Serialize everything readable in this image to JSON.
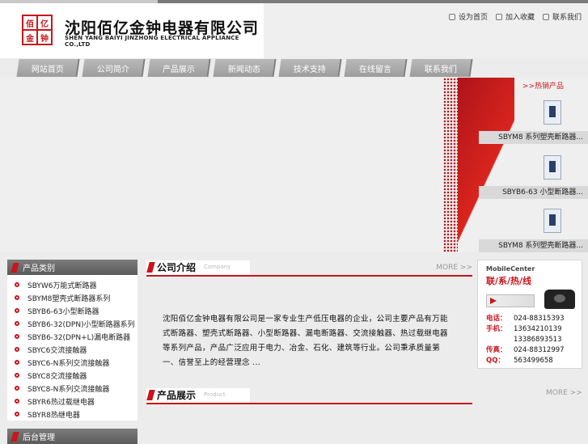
{
  "company": {
    "logo_chars": [
      "佰",
      "亿",
      "金",
      "钟"
    ],
    "name_cn": "沈阳佰亿金钟电器有限公司",
    "name_en": "SHEN YANG BAIYI JINZHONG ELECTRICAL APPLIANCE CO.,LTD"
  },
  "top_links": [
    {
      "label": "设为首页",
      "icon": "home-icon"
    },
    {
      "label": "加入收藏",
      "icon": "star-icon"
    },
    {
      "label": "联系我们",
      "icon": "contact-icon"
    }
  ],
  "nav": [
    "网站首页",
    "公司简介",
    "产品展示",
    "新闻动态",
    "技术支持",
    "在线留言",
    "联系我们"
  ],
  "promo": {
    "hot_label": ">>热销产品",
    "items": [
      {
        "caption": "SBYM8 系列塑壳断路器..."
      },
      {
        "caption": "SBYB6-63 小型断路器..."
      },
      {
        "caption": "SBYM8 系列塑壳断路器..."
      }
    ]
  },
  "sidebar": {
    "title": "产品类别",
    "items": [
      "SBYW6万能式断路器",
      "SBYM8塑壳式断路器系列",
      "SBYB6-63小型断路器",
      "SBYB6-32(DPN)小型断路器系列",
      "SBYB6-32(DPN+L)漏电断路器",
      "SBYC6交流接触器",
      "SBYC6-N系列交流接触器",
      "SBYC8交流接触器",
      "SBYC8-N系列交流接触器",
      "SBYR6热过载继电器",
      "SBYR8热继电器"
    ],
    "admin_title": "后台管理"
  },
  "intro": {
    "title": "公司介绍",
    "subtitle": "Company",
    "more": "MORE >>",
    "text": "沈阳佰亿金钟电器有限公司是一家专业生产低压电器的企业，公司主要产品有万能式断路器、塑壳式断路器、小型断路器、漏电断路器、交流接触器、热过载继电器等系列产品，产品广泛应用于电力、冶金、石化、建筑等行业。公司秉承质量第一、信誉至上的经营理念 ..."
  },
  "products": {
    "title": "产品展示",
    "subtitle": "Product",
    "more": "MORE >>"
  },
  "contact": {
    "mobile_center": "MobileCenter",
    "hotline": "联/系/热/线",
    "rows": [
      {
        "key": "电话：",
        "value": "024-88315393"
      },
      {
        "key": "手机：",
        "value": "13634210139"
      },
      {
        "key": "",
        "value": "13386893513"
      },
      {
        "key": "传真：",
        "value": "024-88312997"
      },
      {
        "key": "QQ：",
        "value": "563499658"
      }
    ]
  }
}
